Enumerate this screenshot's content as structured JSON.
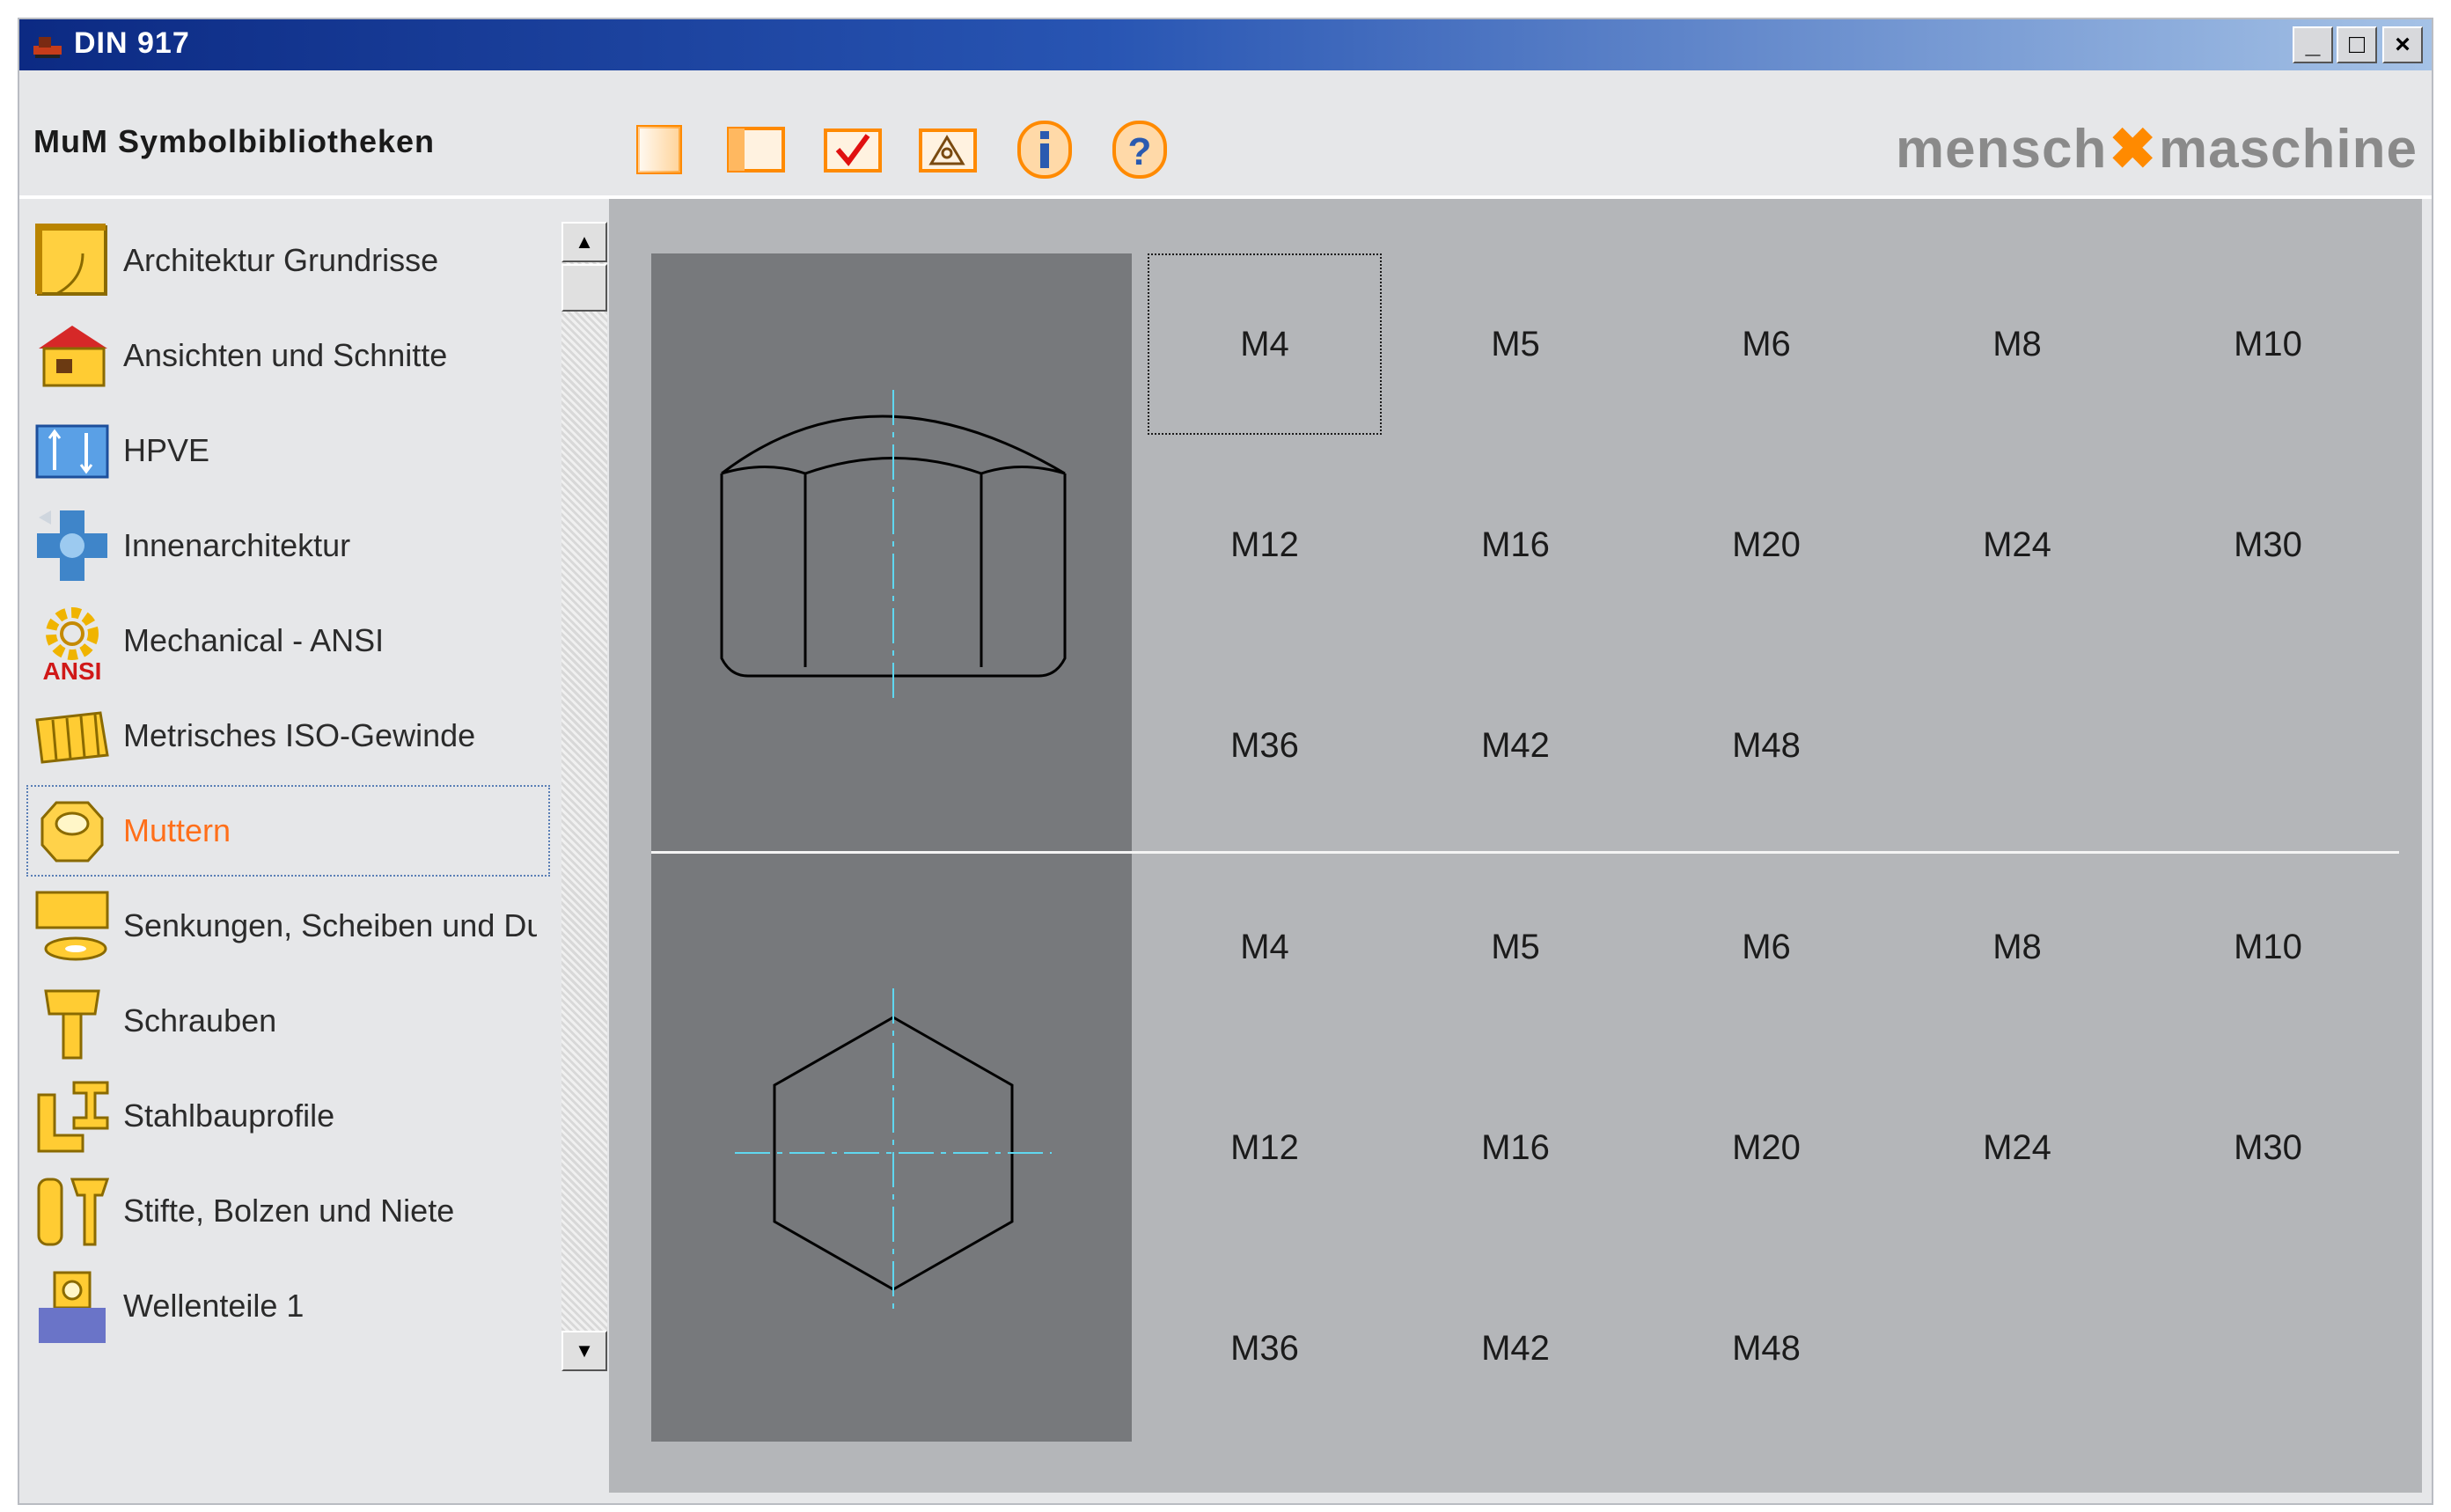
{
  "window": {
    "title": "DIN 917",
    "controls": [
      "_",
      "□",
      "×"
    ]
  },
  "header": {
    "app_title": "MuM Symbolbibliotheken",
    "logo_left": "mensch",
    "logo_right": "maschine",
    "toolbar": [
      {
        "icon": "blank-page-icon"
      },
      {
        "icon": "panel-icon"
      },
      {
        "icon": "checkmark-icon"
      },
      {
        "icon": "insert-icon"
      },
      {
        "icon": "info-icon"
      },
      {
        "icon": "help-icon"
      }
    ]
  },
  "sidebar": {
    "items": [
      {
        "label": "Architektur Grundrisse",
        "icon": "architecture-icon"
      },
      {
        "label": "Ansichten und Schnitte",
        "icon": "house-icon"
      },
      {
        "label": "HPVE",
        "icon": "hpve-icon"
      },
      {
        "label": "Innenarchitektur",
        "icon": "interior-icon"
      },
      {
        "label": "Mechanical - ANSI",
        "icon": "gear-ansi-icon"
      },
      {
        "label": "Metrisches ISO-Gewinde",
        "icon": "thread-icon"
      },
      {
        "label": "Muttern",
        "icon": "nut-icon",
        "selected": true
      },
      {
        "label": "Senkungen, Scheiben und Du",
        "icon": "washer-icon"
      },
      {
        "label": "Schrauben",
        "icon": "screw-icon"
      },
      {
        "label": "Stahlbauprofile",
        "icon": "steel-profile-icon"
      },
      {
        "label": "Stifte, Bolzen und Niete",
        "icon": "pin-icon"
      },
      {
        "label": "Wellenteile 1",
        "icon": "shaft-icon"
      }
    ]
  },
  "content": {
    "top_sizes": [
      "M4",
      "M5",
      "M6",
      "M8",
      "M10",
      "M12",
      "M16",
      "M20",
      "M24",
      "M30",
      "M36",
      "M42",
      "M48"
    ],
    "bottom_sizes": [
      "M4",
      "M5",
      "M6",
      "M8",
      "M10",
      "M12",
      "M16",
      "M20",
      "M24",
      "M30",
      "M36",
      "M42",
      "M48"
    ],
    "colors": {
      "preview_bg": "#77797c",
      "content_bg": "#b4b6b9",
      "centerline": "#5fd7f0",
      "accent": "#ff8a00"
    }
  }
}
